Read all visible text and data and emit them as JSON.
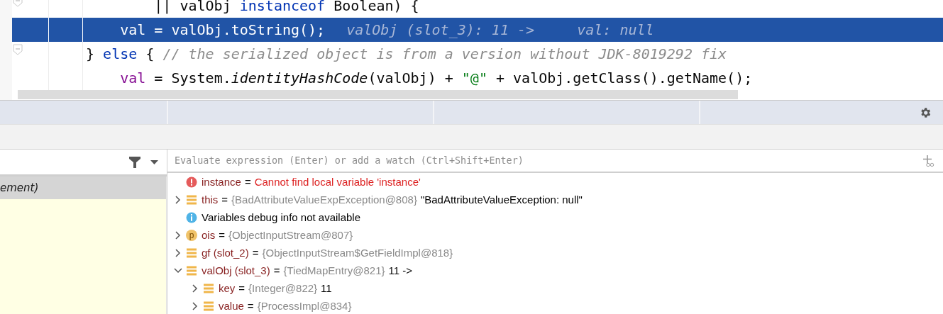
{
  "editor": {
    "lines": [
      {
        "fold": true,
        "selected": false,
        "tokens": [
          {
            "kind": "plain",
            "text": "        || valObj "
          },
          {
            "kind": "keyword",
            "text": "instanceof"
          },
          {
            "kind": "plain",
            "text": " Boolean) {"
          }
        ]
      },
      {
        "fold": false,
        "selected": true,
        "tokens": [
          {
            "kind": "plain",
            "text": "    val = valObj.toString();"
          },
          {
            "kind": "hint",
            "text": "valObj (slot_3): 11 ->     val: null"
          }
        ]
      },
      {
        "fold": true,
        "selected": false,
        "tokens": [
          {
            "kind": "plain",
            "text": "} "
          },
          {
            "kind": "keyword",
            "text": "else"
          },
          {
            "kind": "plain",
            "text": " { "
          },
          {
            "kind": "comment",
            "text": "// the serialized object is from a version without JDK-8019292 fix"
          }
        ]
      },
      {
        "fold": false,
        "selected": false,
        "tokens": [
          {
            "kind": "field",
            "text": "    val"
          },
          {
            "kind": "plain",
            "text": " = System."
          },
          {
            "kind": "static",
            "text": "identityHashCode"
          },
          {
            "kind": "plain",
            "text": "(valObj) + "
          },
          {
            "kind": "string",
            "text": "\"@\""
          },
          {
            "kind": "plain",
            "text": " + valObj.getClass().getName();"
          }
        ]
      }
    ]
  },
  "frames": [
    {
      "label": "ement)",
      "selected": true
    }
  ],
  "evaluate": {
    "placeholder": "Evaluate expression (Enter) or add a watch (Ctrl+Shift+Enter)"
  },
  "variables": [
    {
      "kind": "error",
      "name": "instance",
      "eq": "=",
      "message": "Cannot find local variable 'instance'"
    },
    {
      "kind": "field",
      "name": "this",
      "eq": "=",
      "expanded": false,
      "ref": "{BadAttributeValueExpException@808}",
      "value": "\"BadAttributeValueException: null\""
    },
    {
      "kind": "info",
      "message": "Variables debug info not available"
    },
    {
      "kind": "parameter",
      "badge": "p",
      "name": "ois",
      "eq": "=",
      "expanded": false,
      "ref": "{ObjectInputStream@807}"
    },
    {
      "kind": "field",
      "name": "gf (slot_2)",
      "eq": "=",
      "expanded": false,
      "ref": "{ObjectInputStream$GetFieldImpl@818}"
    },
    {
      "kind": "field",
      "name": "valObj (slot_3)",
      "eq": "=",
      "expanded": true,
      "ref": "{TiedMapEntry@821}",
      "value": "11 ->",
      "children": [
        {
          "kind": "field",
          "name": "key",
          "eq": "=",
          "expanded": false,
          "ref": "{Integer@822}",
          "value": "11"
        },
        {
          "kind": "field",
          "name": "value",
          "eq": "=",
          "expanded": false,
          "ref": "{ProcessImpl@834}"
        }
      ]
    }
  ]
}
